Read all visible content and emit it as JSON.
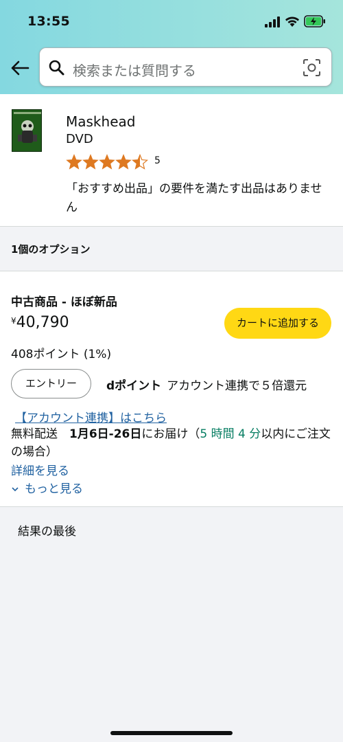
{
  "status": {
    "time": "13:55"
  },
  "search": {
    "placeholder": "検索または質問する"
  },
  "product": {
    "title": "Maskhead",
    "format": "DVD",
    "rating": 4.5,
    "rating_count": "5",
    "notice": "「おすすめ出品」の要件を満たす出品はありません",
    "thumb_text": "MASKHEAD"
  },
  "options": {
    "header": "1個のオプション"
  },
  "offer": {
    "condition": "中古商品 - ほぼ新品",
    "currency": "¥",
    "price": "40,790",
    "cart_label": "カートに追加する",
    "points": "408ポイント (1%)",
    "entry_label": "エントリー",
    "dpoint_bold": "dポイント",
    "dpoint_text": "アカウント連携で５倍還元",
    "account_link": "【アカウント連携】はこちら",
    "delivery_prefix": "無料配送",
    "delivery_date": "1月6日-26日",
    "delivery_mid": "にお届け（",
    "delivery_countdown": "5 時間 4 分",
    "delivery_suffix": "以内にご注文の場合）",
    "details_link": "詳細を見る",
    "more_link": "もっと見る"
  },
  "footer": {
    "end_text": "結果の最後"
  },
  "colors": {
    "accent_yellow": "#ffd814",
    "link_blue": "#2162a1",
    "star_orange": "#de7921",
    "countdown_green": "#067d62"
  }
}
